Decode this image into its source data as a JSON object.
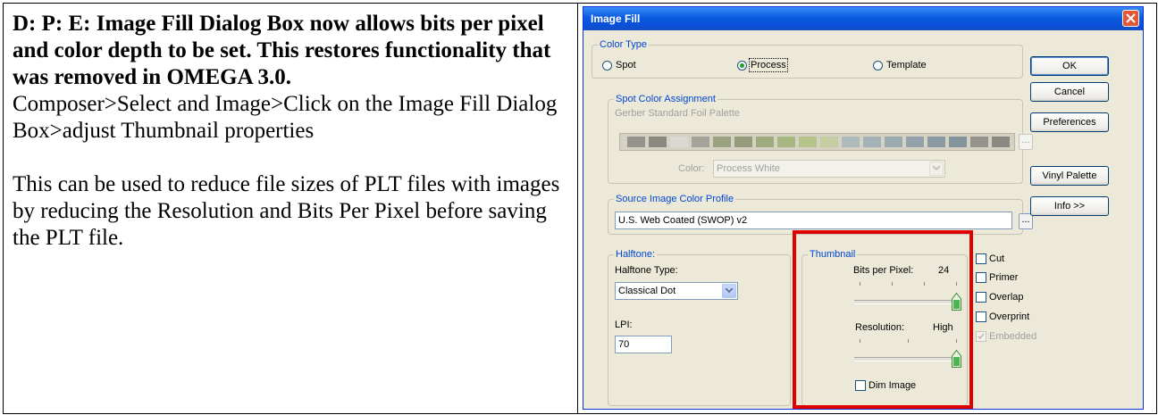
{
  "doc": {
    "heading": "D: P: E: Image Fill Dialog Box now allows bits per pixel and color depth to be set.  This restores functionality that was removed in OMEGA 3.0.",
    "para1": "Composer>Select and Image>Click on the Image Fill Dialog Box>adjust Thumbnail properties",
    "para2": "This can be used to reduce file sizes of PLT files with images by reducing the Resolution and Bits Per Pixel before saving the PLT file."
  },
  "dialog": {
    "title": "Image Fill",
    "color_type": {
      "label": "Color Type",
      "options": [
        "Spot",
        "Process",
        "Template"
      ],
      "selected": "Process"
    },
    "spot_color": {
      "label": "Spot Color Assignment",
      "palette_name": "Gerber Standard Foil Palette",
      "color_label": "Color:",
      "color_value": "Process White",
      "ellipsis": "..."
    },
    "source_profile": {
      "label": "Source Image Color Profile",
      "value": "U.S. Web Coated (SWOP) v2",
      "ellipsis": "..."
    },
    "halftone": {
      "label": "Halftone:",
      "type_label": "Halftone Type:",
      "type_value": "Classical Dot",
      "lpi_label": "LPI:",
      "lpi_value": "70"
    },
    "thumbnail": {
      "label": "Thumbnail",
      "bpp_label": "Bits per Pixel:",
      "bpp_value": "24",
      "bpp_slider_level": 1.0,
      "resolution_label": "Resolution:",
      "resolution_value": "High",
      "resolution_slider_level": 1.0,
      "dim_label": "Dim Image",
      "dim_checked": false
    },
    "buttons": {
      "ok": "OK",
      "cancel": "Cancel",
      "preferences": "Preferences",
      "vinyl": "Vinyl Palette",
      "info": "Info >>"
    },
    "checks": [
      {
        "label": "Cut",
        "checked": false,
        "enabled": true
      },
      {
        "label": "Primer",
        "checked": false,
        "enabled": true
      },
      {
        "label": "Overlap",
        "checked": false,
        "enabled": true
      },
      {
        "label": "Overprint",
        "checked": false,
        "enabled": true
      },
      {
        "label": "Embedded",
        "checked": true,
        "enabled": false
      }
    ],
    "colors": {
      "title_bar": "#0a5ae0",
      "dialog_bg": "#ece9d8",
      "highlight_box": "#e00000"
    }
  }
}
